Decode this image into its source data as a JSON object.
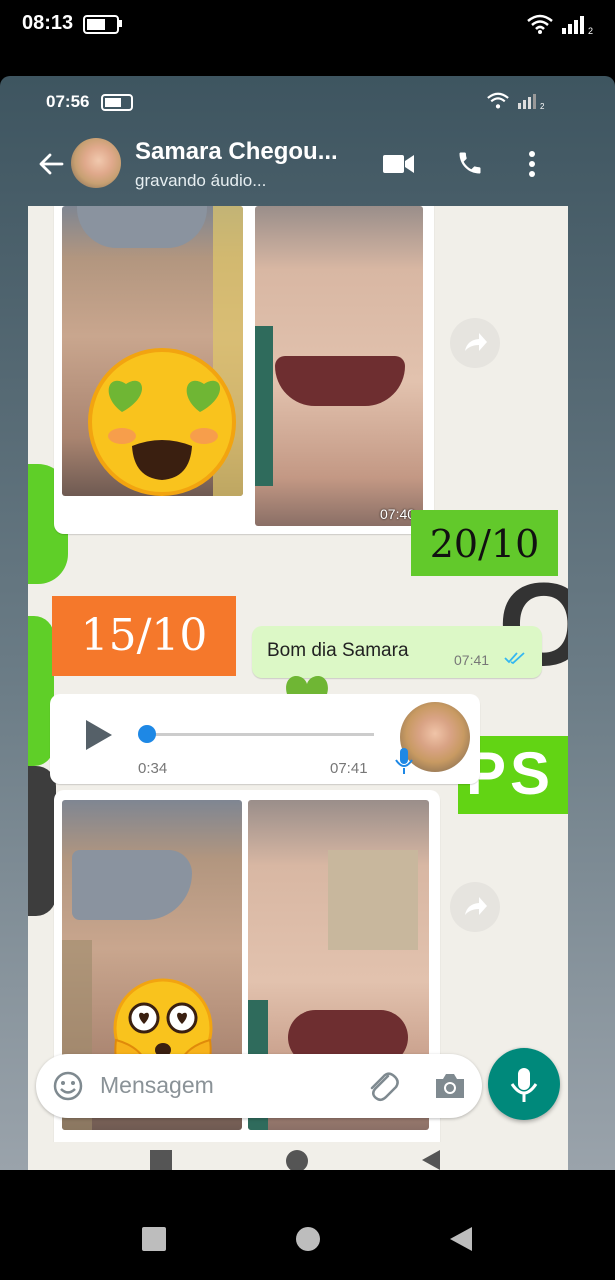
{
  "outer_status": {
    "time": "08:13"
  },
  "inner_status": {
    "time": "07:56"
  },
  "header": {
    "contact_name": "Samara Chegou...",
    "status": "gravando áudio..."
  },
  "messages": {
    "photo1": {
      "date_label_left": "15/10",
      "date_label_right": "20/10",
      "time": "07:40"
    },
    "text1": {
      "text": "Bom dia Samara",
      "time": "07:41"
    },
    "voice": {
      "duration": "0:34",
      "time": "07:41"
    }
  },
  "background_letters": {
    "o": "O",
    "ps": "PS"
  },
  "composer": {
    "placeholder": "Mensagem"
  },
  "colors": {
    "header_bg": "#3f5561",
    "accent_green": "#00897b",
    "out_bubble": "#dcf8c6",
    "date_orange": "#f5782b",
    "date_green": "#62c92b",
    "voice_dot": "#1e88e5"
  }
}
